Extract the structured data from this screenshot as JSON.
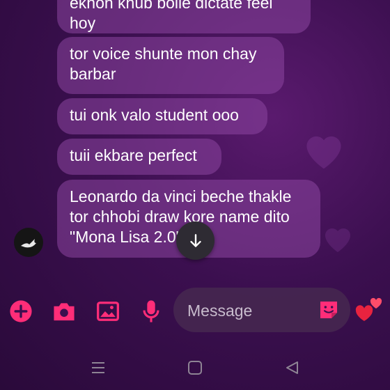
{
  "messages": [
    {
      "text": "ekhon khub bolle dictate feel hoy"
    },
    {
      "text": "tor voice shunte mon chay barbar"
    },
    {
      "text": "tui onk valo student ooo"
    },
    {
      "text": "tuii ekbare perfect"
    },
    {
      "text": "Leonardo da vinci beche thakle tor chhobi draw kore name dito \"Mona Lisa 2.0\""
    }
  ],
  "composer": {
    "placeholder": "Message",
    "accent_color": "#ff2d78"
  },
  "icons": {
    "add": "plus-circle-icon",
    "camera": "camera-icon",
    "gallery": "image-icon",
    "mic": "microphone-icon",
    "sticker": "sticker-icon",
    "reaction": "hearts-icon",
    "scroll": "arrow-down-icon"
  }
}
